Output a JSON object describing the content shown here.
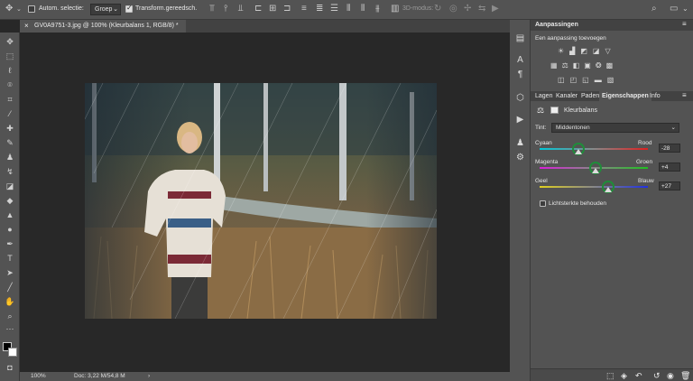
{
  "options_bar": {
    "auto_select_label": "Autom. selectie:",
    "auto_select_value": "Groep",
    "transform_label": "Transform.gereedsch.",
    "mode_3d_label": "3D-modus:"
  },
  "document": {
    "tab_title": "GV0A9751-3.jpg @ 100% (Kleurbalans 1, RGB/8) *"
  },
  "status": {
    "zoom": "100%",
    "doc_size": "Doc: 3,22 M/54,8 M"
  },
  "adjustments_panel": {
    "title": "Aanpassingen",
    "subtitle": "Een aanpassing toevoegen"
  },
  "properties_panel": {
    "tabs": [
      "Lagen",
      "Kanaler",
      "Paden",
      "Eigenschappen",
      "Info"
    ],
    "active_tab": "Eigenschappen",
    "layer_title": "Kleurbalans",
    "tint_label": "Tint:",
    "tint_value": "Middentonen",
    "sliders": [
      {
        "left": "Cyaan",
        "right": "Rood",
        "value": "-28",
        "position": 0.36
      },
      {
        "left": "Magenta",
        "right": "Groen",
        "value": "+4",
        "position": 0.52
      },
      {
        "left": "Geel",
        "right": "Blauw",
        "value": "+27",
        "position": 0.635
      }
    ],
    "preserve_luminosity_label": "Lichtsterkte behouden",
    "preserve_luminosity_checked": false
  }
}
